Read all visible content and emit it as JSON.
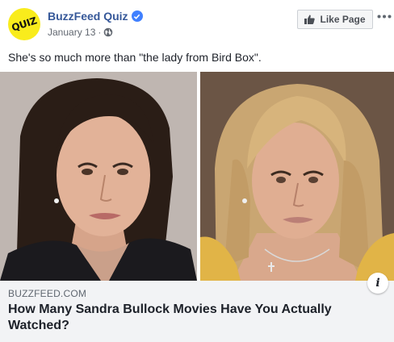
{
  "header": {
    "avatar_text": "QUIZ",
    "page_name": "BuzzFeed Quiz",
    "date": "January 13",
    "separator": "·",
    "like_button_label": "Like Page",
    "more_icon": "ellipsis-icon",
    "verified_icon": "verified-badge-icon",
    "audience_icon": "globe-icon"
  },
  "post": {
    "caption": "She's so much more than \"the lady from Bird Box\"."
  },
  "link_preview": {
    "domain": "BUZZFEED.COM",
    "headline": "How Many Sandra Bullock Movies Have You Actually Watched?",
    "info_icon": "info-icon",
    "info_label": "i"
  },
  "colors": {
    "link_blue": "#365899",
    "avatar_yellow": "#f9ec1c",
    "verified_blue": "#4080ff",
    "preview_bg": "#f2f3f5"
  }
}
